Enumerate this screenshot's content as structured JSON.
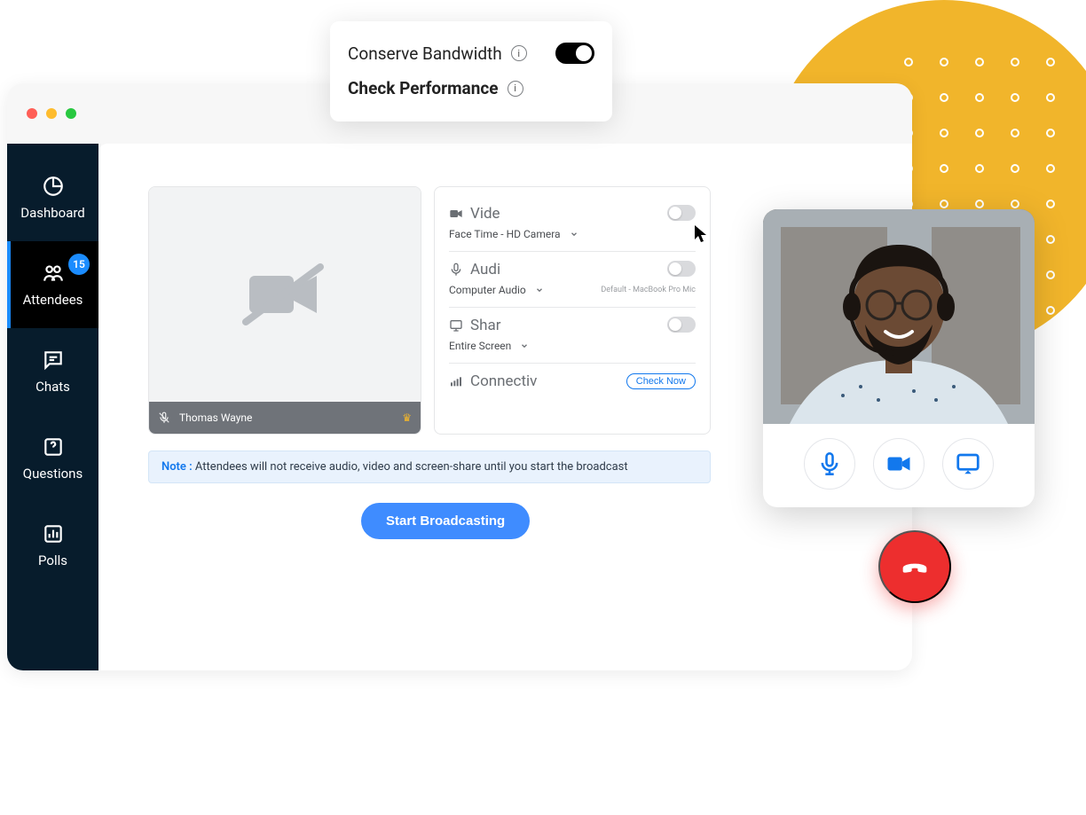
{
  "popover": {
    "conserve": "Conserve Bandwidth",
    "check_perf": "Check Performance"
  },
  "sidebar": {
    "dashboard": "Dashboard",
    "attendees": "Attendees",
    "attendees_badge": "15",
    "chats": "Chats",
    "questions": "Questions",
    "polls": "Polls"
  },
  "preview": {
    "participant": "Thomas Wayne"
  },
  "settings": {
    "video_label": "Vide",
    "video_source": "Face Time - HD Camera",
    "audio_label": "Audi",
    "audio_source": "Computer Audio",
    "audio_hint": "Default - MacBook Pro Mic",
    "share_label": "Shar",
    "share_source": "Entire Screen",
    "connect_label": "Connectiv",
    "check_now": "Check Now"
  },
  "note": {
    "label": "Note :",
    "text": " Attendees will not receive audio, video and screen-share until you start the broadcast"
  },
  "buttons": {
    "start": "Start Broadcasting"
  }
}
